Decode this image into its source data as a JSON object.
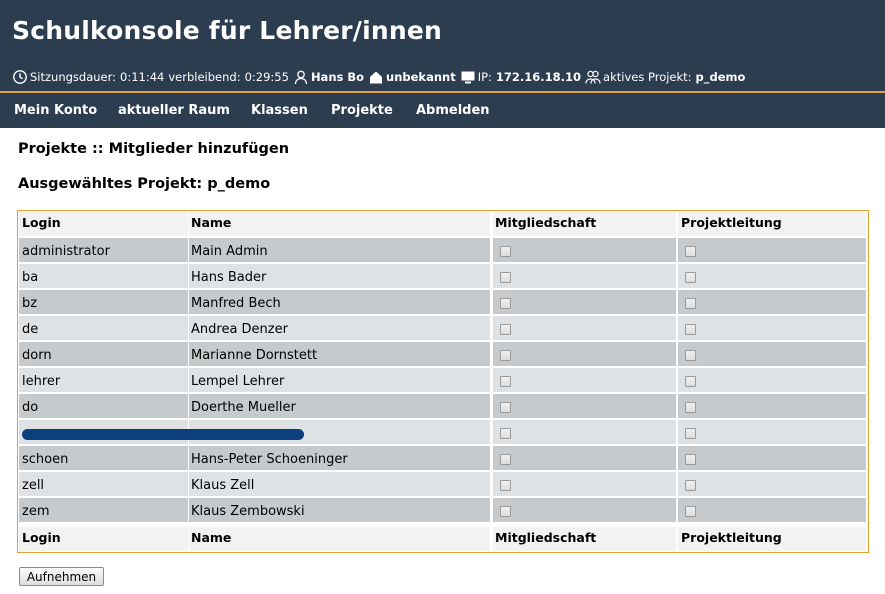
{
  "header": {
    "title": "Schulkonsole für Lehrer/innen",
    "session_label": "Sitzungsdauer:",
    "session_duration": "0:11:44",
    "remaining_label": "verbleibend:",
    "remaining": "0:29:55",
    "user": "Hans Bo",
    "room": "unbekannt",
    "ip_label": "IP:",
    "ip": "172.16.18.10",
    "project_label": "aktives Projekt:",
    "project": "p_demo"
  },
  "nav": {
    "items": [
      "Mein Konto",
      "aktueller Raum",
      "Klassen",
      "Projekte",
      "Abmelden"
    ]
  },
  "page": {
    "title": "Projekte :: Mitglieder hinzufügen",
    "subtitle": "Ausgewähltes Projekt: p_demo"
  },
  "table": {
    "columns": [
      "Login",
      "Name",
      "Mitgliedschaft",
      "Projektleitung"
    ],
    "rows": [
      {
        "login": "administrator",
        "name": "Main Admin"
      },
      {
        "login": "ba",
        "name": "Hans Bader"
      },
      {
        "login": "bz",
        "name": "Manfred Bech"
      },
      {
        "login": "de",
        "name": "Andrea Denzer"
      },
      {
        "login": "dorn",
        "name": "Marianne Dornstett"
      },
      {
        "login": "lehrer",
        "name": "Lempel Lehrer"
      },
      {
        "login": "do",
        "name": "Doerthe Mueller"
      },
      {
        "login": "",
        "name": ""
      },
      {
        "login": "schoen",
        "name": "Hans-Peter Schoeninger"
      },
      {
        "login": "zell",
        "name": "Klaus Zell"
      },
      {
        "login": "zem",
        "name": "Klaus Zembowski"
      }
    ]
  },
  "actions": {
    "submit_label": "Aufnehmen"
  },
  "colors": {
    "header_bg": "#2b3d4f",
    "accent": "#e8a030",
    "row_dark": "#c6cacd",
    "row_light": "#dfe2e5",
    "redaction": "#0b3f7e"
  }
}
